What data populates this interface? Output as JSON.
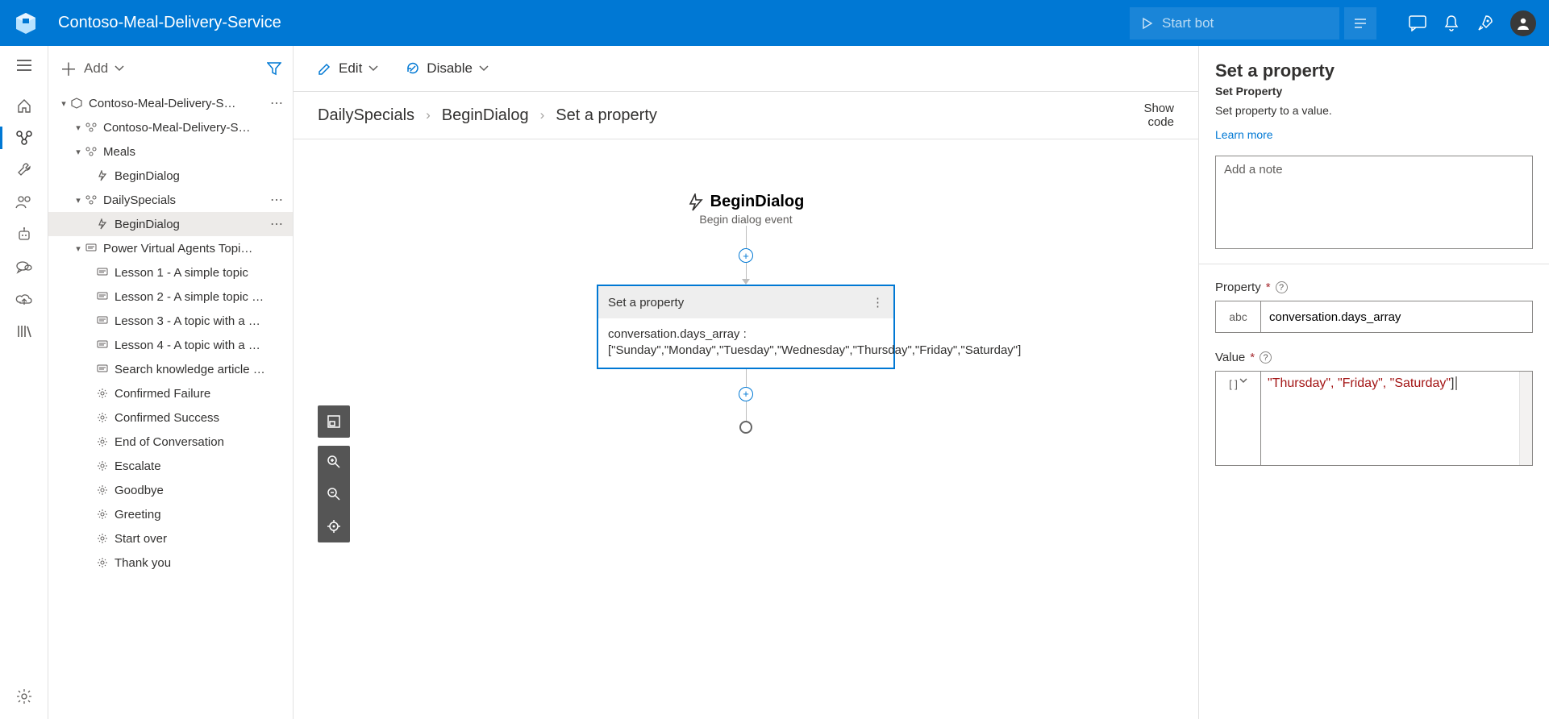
{
  "header": {
    "title": "Contoso-Meal-Delivery-Service",
    "start_bot": "Start bot"
  },
  "tree_toolbar": {
    "add": "Add"
  },
  "tree": {
    "root": "Contoso-Meal-Delivery-S…",
    "bot": "Contoso-Meal-Delivery-S…",
    "meals": "Meals",
    "meals_begin": "BeginDialog",
    "dailyspecials": "DailySpecials",
    "dailyspecials_begin": "BeginDialog",
    "pva": "Power Virtual Agents Topi…",
    "lesson1": "Lesson 1 - A simple topic",
    "lesson2": "Lesson 2 - A simple topic …",
    "lesson3": "Lesson 3 - A topic with a …",
    "lesson4": "Lesson 4 - A topic with a …",
    "searchkb": "Search knowledge article …",
    "confirmed_failure": "Confirmed Failure",
    "confirmed_success": "Confirmed Success",
    "end_conv": "End of Conversation",
    "escalate": "Escalate",
    "goodbye": "Goodbye",
    "greeting": "Greeting",
    "startover": "Start over",
    "thankyou": "Thank you"
  },
  "center_toolbar": {
    "edit": "Edit",
    "disable": "Disable"
  },
  "breadcrumb": {
    "a": "DailySpecials",
    "b": "BeginDialog",
    "c": "Set a property"
  },
  "showcode": {
    "l1": "Show",
    "l2": "code"
  },
  "begin_node": {
    "title": "BeginDialog",
    "subtitle": "Begin dialog event"
  },
  "card": {
    "title": "Set a property",
    "body": "conversation.days_array :\n[\"Sunday\",\"Monday\",\"Tuesday\",\"Wednesday\",\"Thursday\",\"Friday\",\"Saturday\"]"
  },
  "rpanel": {
    "heading": "Set a property",
    "subheading": "Set Property",
    "description": "Set property to a value.",
    "learn_more": "Learn more",
    "note_placeholder": "Add a note",
    "property_label": "Property",
    "property_prefix": "abc",
    "property_value": "conversation.days_array",
    "value_label": "Value",
    "value_prefix": "[ ]",
    "value_code_prefix": "\"Thursday\", \"Friday\", \"Saturday\"",
    "value_code_suffix": "]"
  }
}
